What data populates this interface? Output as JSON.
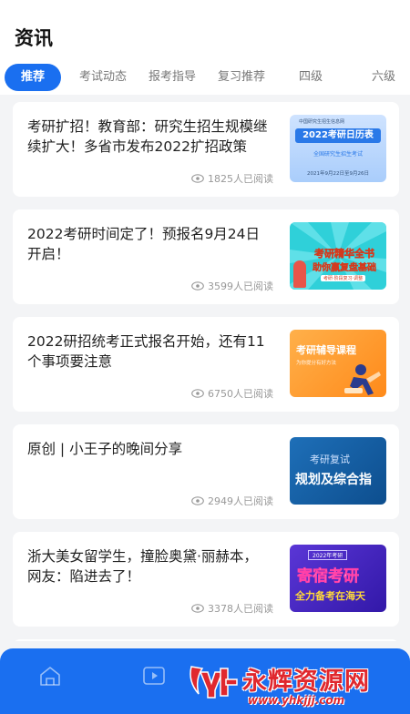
{
  "header": {
    "title": "资讯"
  },
  "tabs": [
    {
      "label": "推荐",
      "active": true
    },
    {
      "label": "考试动态",
      "active": false
    },
    {
      "label": "报考指导",
      "active": false
    },
    {
      "label": "复习推荐",
      "active": false
    },
    {
      "label": "四级",
      "active": false
    },
    {
      "label": "六级",
      "active": false
    }
  ],
  "articles": [
    {
      "title": "考研扩招！教育部：研究生招生规模继续扩大！多省市发布2022扩招政策",
      "reads": "1825人已阅读",
      "thumb_texts": [
        "中国研究生招生信息网",
        "2022考研日历表",
        "全国研究生招生考试",
        "2021年9月22日至9月26日"
      ]
    },
    {
      "title": "2022考研时间定了！预报名9月24日开启！",
      "reads": "3599人已阅读",
      "thumb_texts": [
        "考研精华全书",
        "助你赢复盘基础",
        "考研·阶段复习·调整"
      ]
    },
    {
      "title": "2022研招统考正式报名开始，还有11个事项要注意",
      "reads": "6750人已阅读",
      "thumb_texts": [
        "考研辅导课程",
        "为你提分有好方法"
      ]
    },
    {
      "title": "原创 | 小王子的晚间分享",
      "reads": "2949人已阅读",
      "thumb_texts": [
        "考研复试",
        "规划及综合指"
      ]
    },
    {
      "title": "浙大美女留学生，撞脸奥黛·丽赫本，网友：陷进去了！",
      "reads": "3378人已阅读",
      "thumb_texts": [
        "2022年考研",
        "寄宿考研",
        "全力备考在海天"
      ]
    }
  ],
  "tabbar": {
    "icons": [
      "home-icon",
      "video-icon"
    ]
  },
  "watermark": {
    "text": "永辉资源网",
    "url": "www.yhkjjj.com"
  },
  "colors": {
    "accent": "#1a6ff0",
    "watermark": "#e0282e"
  }
}
